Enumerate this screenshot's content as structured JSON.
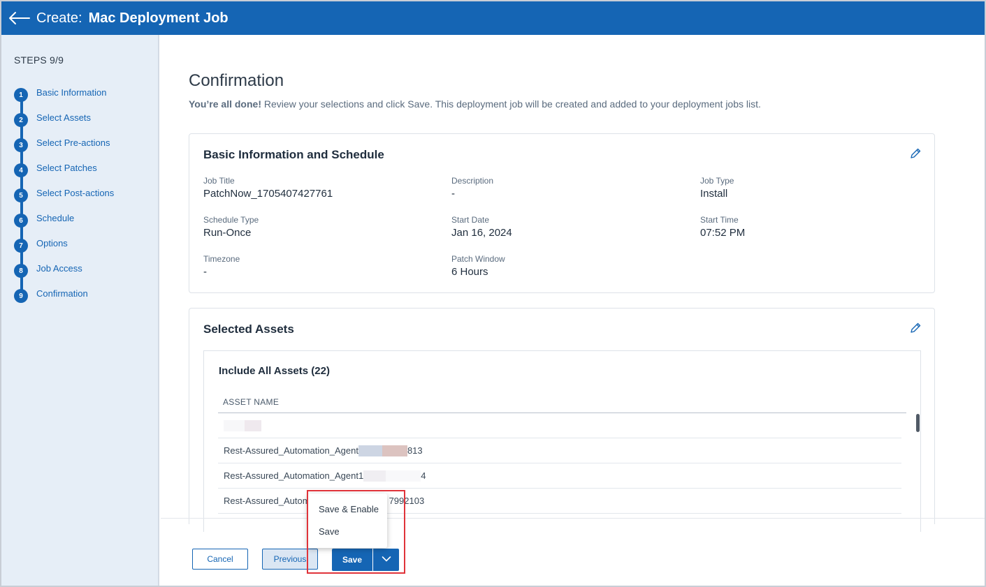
{
  "header": {
    "title_prefix": "Create:",
    "title_main": "Mac Deployment Job"
  },
  "sidebar": {
    "steps_label": "STEPS 9/9",
    "steps": [
      {
        "num": "1",
        "label": "Basic Information"
      },
      {
        "num": "2",
        "label": "Select Assets"
      },
      {
        "num": "3",
        "label": "Select Pre-actions"
      },
      {
        "num": "4",
        "label": "Select Patches"
      },
      {
        "num": "5",
        "label": "Select Post-actions"
      },
      {
        "num": "6",
        "label": "Schedule"
      },
      {
        "num": "7",
        "label": "Options"
      },
      {
        "num": "8",
        "label": "Job Access"
      },
      {
        "num": "9",
        "label": "Confirmation"
      }
    ]
  },
  "main": {
    "title": "Confirmation",
    "subtitle_bold": "You’re all done!",
    "subtitle_rest": " Review your selections and click Save. This deployment job will be created and added to your deployment jobs list."
  },
  "basic_info": {
    "title": "Basic Information and Schedule",
    "fields": [
      {
        "label": "Job Title",
        "value": "PatchNow_1705407427761"
      },
      {
        "label": "Description",
        "value": "-"
      },
      {
        "label": "Job Type",
        "value": "Install"
      },
      {
        "label": "Schedule Type",
        "value": "Run-Once"
      },
      {
        "label": "Start Date",
        "value": "Jan 16, 2024"
      },
      {
        "label": "Start Time",
        "value": "07:52 PM"
      },
      {
        "label": "Timezone",
        "value": "-"
      },
      {
        "label": "Patch Window",
        "value": "6 Hours"
      }
    ]
  },
  "assets": {
    "title": "Selected Assets",
    "include_label": "Include All Assets (22)",
    "column_header": "ASSET NAME",
    "rows": [
      {
        "prefix": "",
        "suffix": ""
      },
      {
        "prefix": "Rest-Assured_Automation_Agent",
        "suffix": "813"
      },
      {
        "prefix": "Rest-Assured_Automation_Agent1",
        "suffix": "4"
      },
      {
        "prefix": "Rest-Assured_Autom",
        "suffix": "7992103"
      }
    ]
  },
  "footer": {
    "cancel_label": "Cancel",
    "previous_label": "Previous",
    "save_label": "Save",
    "menu": [
      "Save & Enable",
      "Save"
    ]
  },
  "colors": {
    "primary": "#1565b4",
    "sidebar_bg": "#e6eef7",
    "highlight": "#e0333a"
  }
}
